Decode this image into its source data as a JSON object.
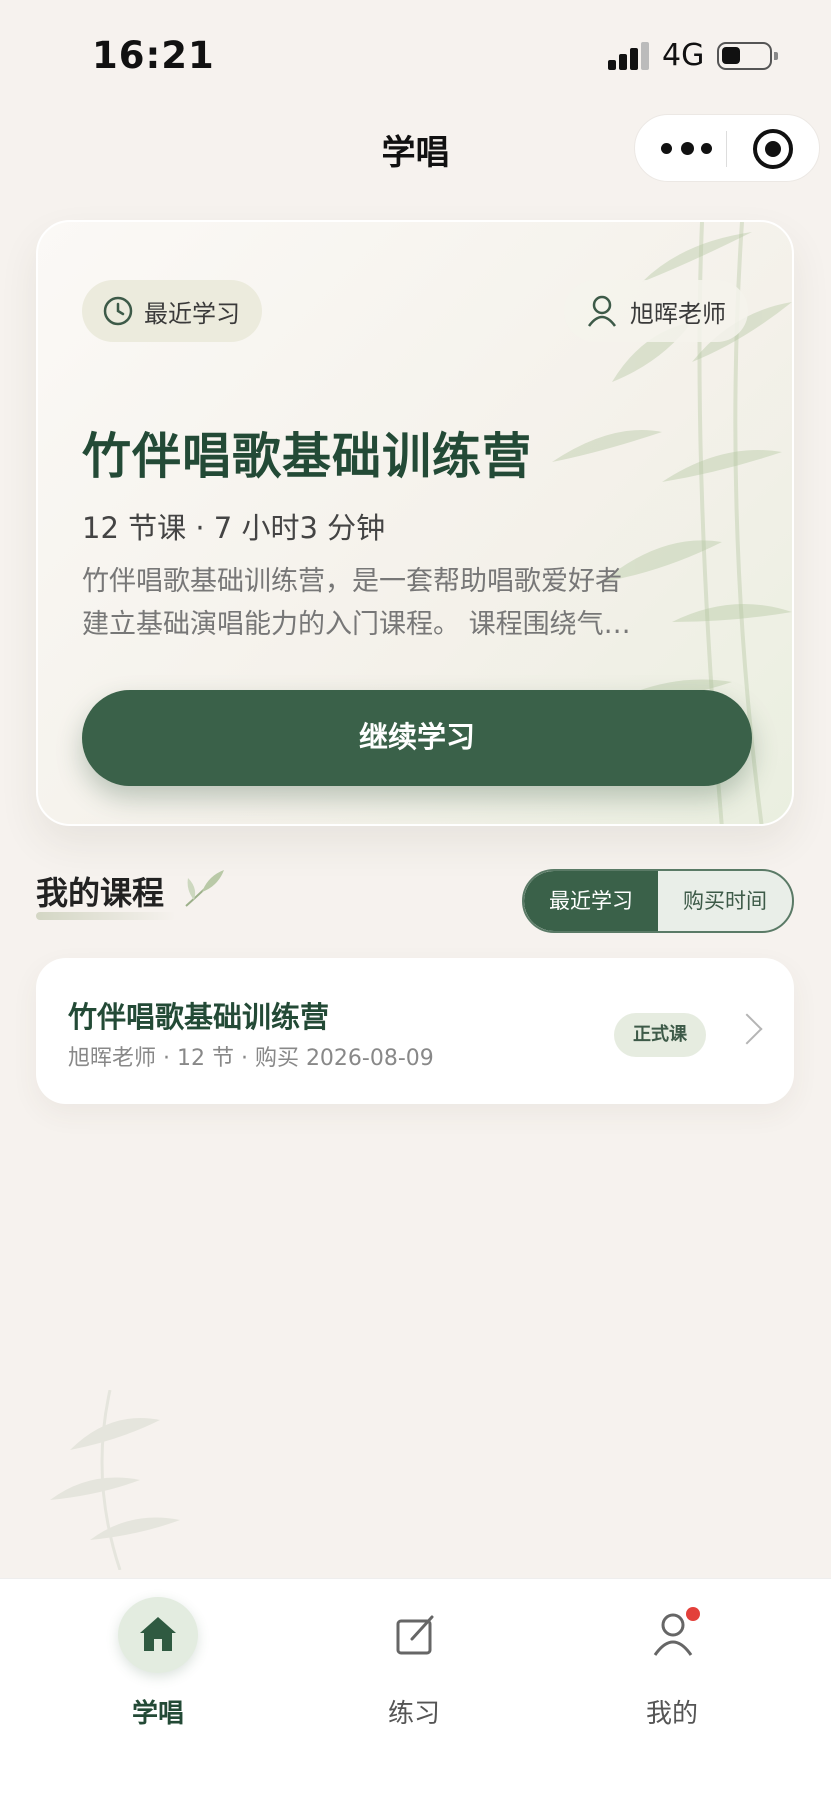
{
  "status_bar": {
    "time": "16:21",
    "network": "4G"
  },
  "header": {
    "title": "学唱"
  },
  "hero": {
    "recent_label": "最近学习",
    "teacher": "旭晖老师",
    "course_title": "竹伴唱歌基础训练营",
    "meta": "12 节课 · 7 小时3 分钟",
    "description": "竹伴唱歌基础训练营，是一套帮助唱歌爱好者建立基础演唱能力的入门课程。 课程围绕气…",
    "continue_label": "继续学习"
  },
  "my_courses": {
    "title": "我的课程",
    "sort_options": [
      "最近学习",
      "购买时间"
    ],
    "selected_sort": "最近学习",
    "items": [
      {
        "name": "竹伴唱歌基础训练营",
        "meta": "旭晖老师 · 12 节 · 购买 2026-08-09",
        "badge": "正式课"
      }
    ]
  },
  "tabbar": {
    "items": [
      {
        "label": "学唱",
        "icon": "home-icon",
        "active": true
      },
      {
        "label": "练习",
        "icon": "edit-icon",
        "active": false
      },
      {
        "label": "我的",
        "icon": "user-icon",
        "active": false,
        "has_dot": true
      }
    ]
  },
  "colors": {
    "primary": "#3a6149",
    "title_green": "#234a36",
    "background": "#f6f2ee",
    "dot": "#e3403b"
  }
}
